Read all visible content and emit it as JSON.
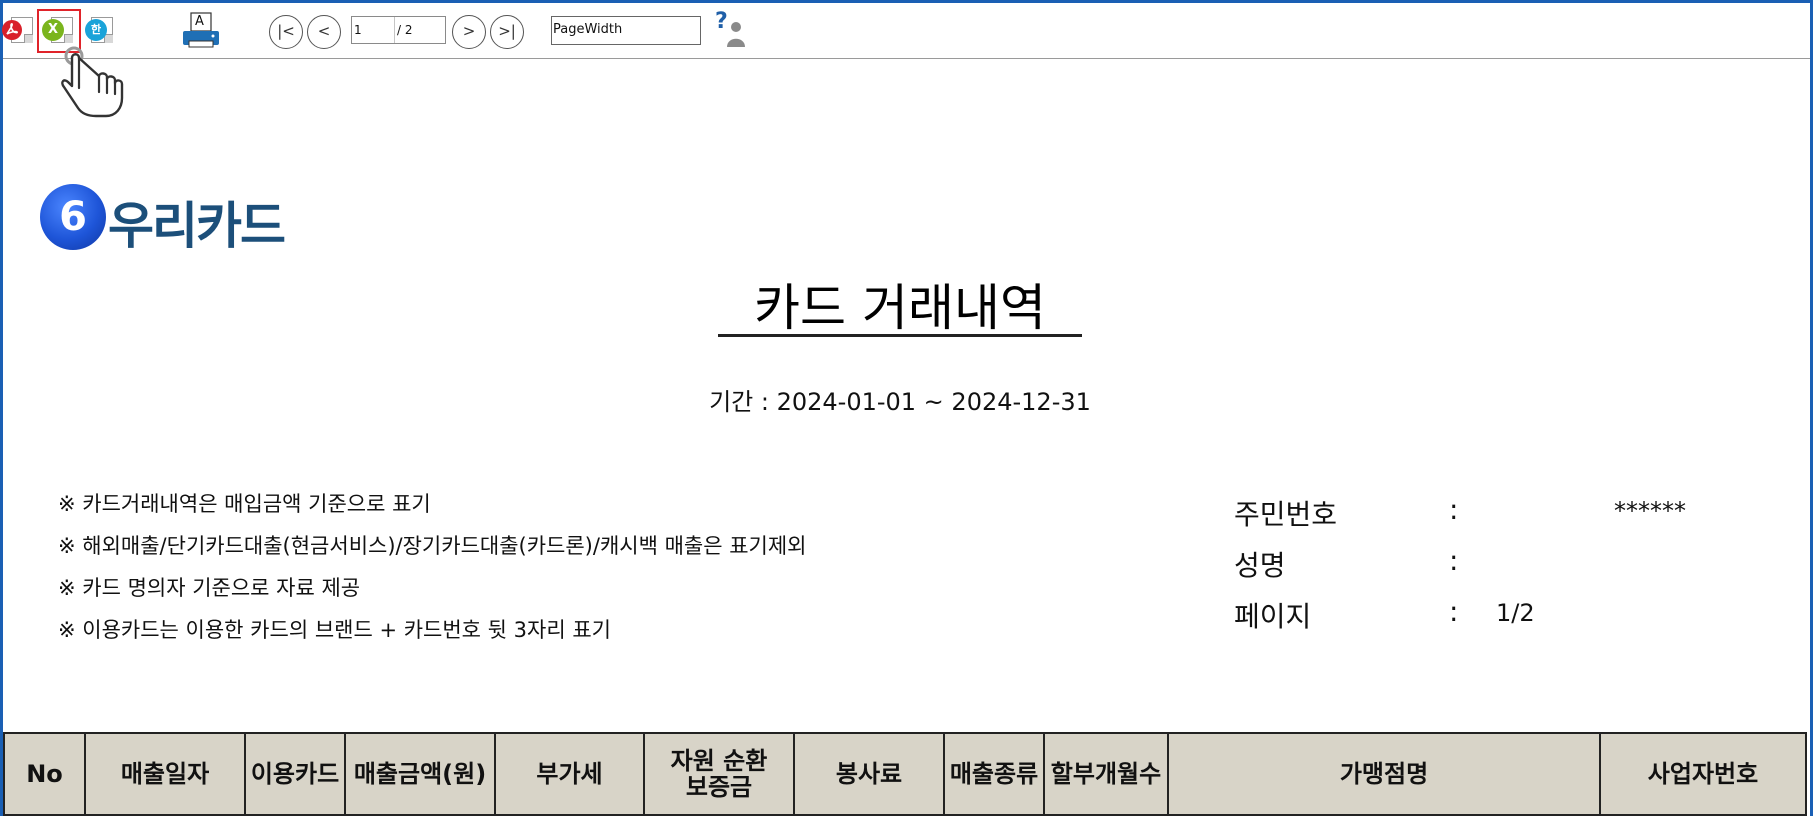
{
  "toolbar": {
    "pdf_export_label": "PDF",
    "excel_export_label": "X",
    "hwp_export_label": "한",
    "print_label": "A",
    "nav_first": "|<",
    "nav_prev": "<",
    "nav_next": ">",
    "nav_last": ">|",
    "current_page": "1",
    "total_pages": "/ 2",
    "zoom_value": "PageWidth",
    "help_label": "?"
  },
  "logo": {
    "badge": "6",
    "brand": "우리카드"
  },
  "report": {
    "title": "카드 거래내역",
    "period": "기간 : 2024-01-01 ~ 2024-12-31",
    "notes": [
      "※ 카드거래내역은 매입금액 기준으로 표기",
      "※ 해외매출/단기카드대출(현금서비스)/장기카드대출(카드론)/캐시백 매출은 표기제외",
      "※ 카드 명의자 기준으로 자료 제공",
      "※ 이용카드는 이용한 카드의 브랜드 + 카드번호 뒷 3자리 표기"
    ],
    "info": [
      {
        "label": "주민번호",
        "colon": ":",
        "value": "******"
      },
      {
        "label": "성명",
        "colon": ":",
        "value": ""
      },
      {
        "label": "페이지",
        "colon": ":",
        "value": "1/2"
      }
    ]
  },
  "table": {
    "headers": [
      "No",
      "매출일자",
      "이용카드",
      "매출금액(원)",
      "부가세",
      "자원 순환\n보증금",
      "봉사료",
      "매출종류",
      "할부개월수",
      "가맹점명",
      "사업자번호"
    ]
  },
  "colors": {
    "frame": "#1a5fb4",
    "highlight": "#e0232a",
    "header_bg": "#d8d4c8",
    "brand_text": "#1c4f7a",
    "brand_badge": "#1e55d8"
  }
}
